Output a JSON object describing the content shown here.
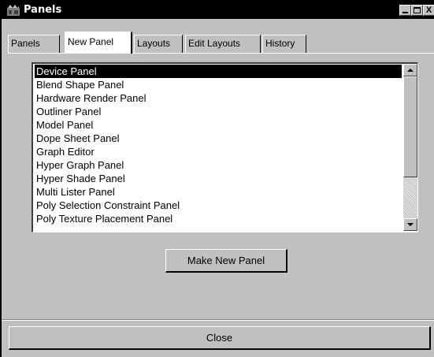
{
  "window": {
    "title": "Panels"
  },
  "titlebar_buttons": {
    "minimize": "_",
    "maximize": "□",
    "close": "X"
  },
  "tabs": [
    {
      "label": "Panels",
      "active": false
    },
    {
      "label": "New Panel",
      "active": true
    },
    {
      "label": "Layouts",
      "active": false
    },
    {
      "label": "Edit Layouts",
      "active": false
    },
    {
      "label": "History",
      "active": false
    }
  ],
  "panel_list": {
    "selected": "Device Panel",
    "items": [
      "Device Panel",
      "Blend Shape Panel",
      "Hardware Render Panel",
      "Outliner Panel",
      "Model Panel",
      "Dope Sheet Panel",
      "Graph Editor",
      "Hyper Graph Panel",
      "Hyper Shade Panel",
      "Multi Lister Panel",
      "Poly Selection Constraint Panel",
      "Poly Texture Placement Panel"
    ]
  },
  "buttons": {
    "make_new_panel": "Make New Panel",
    "close": "Close"
  },
  "icons": {
    "app": "maya-panels-icon",
    "scroll_up": "arrow-up-icon",
    "scroll_down": "arrow-down-icon"
  }
}
